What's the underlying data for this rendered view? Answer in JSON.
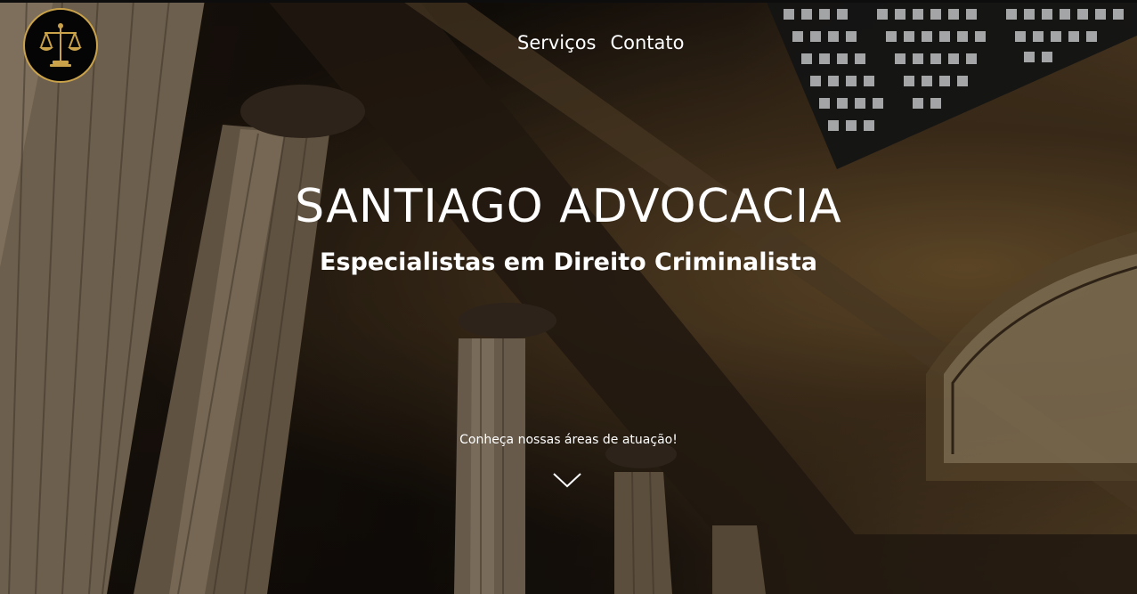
{
  "brand": {
    "logo_icon": "scales-of-justice-icon",
    "logo_color": "#c9a24a"
  },
  "nav": {
    "items": [
      {
        "label": "Serviços"
      },
      {
        "label": "Contato"
      }
    ]
  },
  "hero": {
    "title": "SANTIAGO ADVOCACIA",
    "subtitle": "Especialistas em Direito Criminalista",
    "cta_text": "Conheça nossas áreas de atuação!",
    "cta_icon": "chevron-down-icon"
  },
  "colors": {
    "text": "#ffffff",
    "gold": "#c9a24a"
  }
}
